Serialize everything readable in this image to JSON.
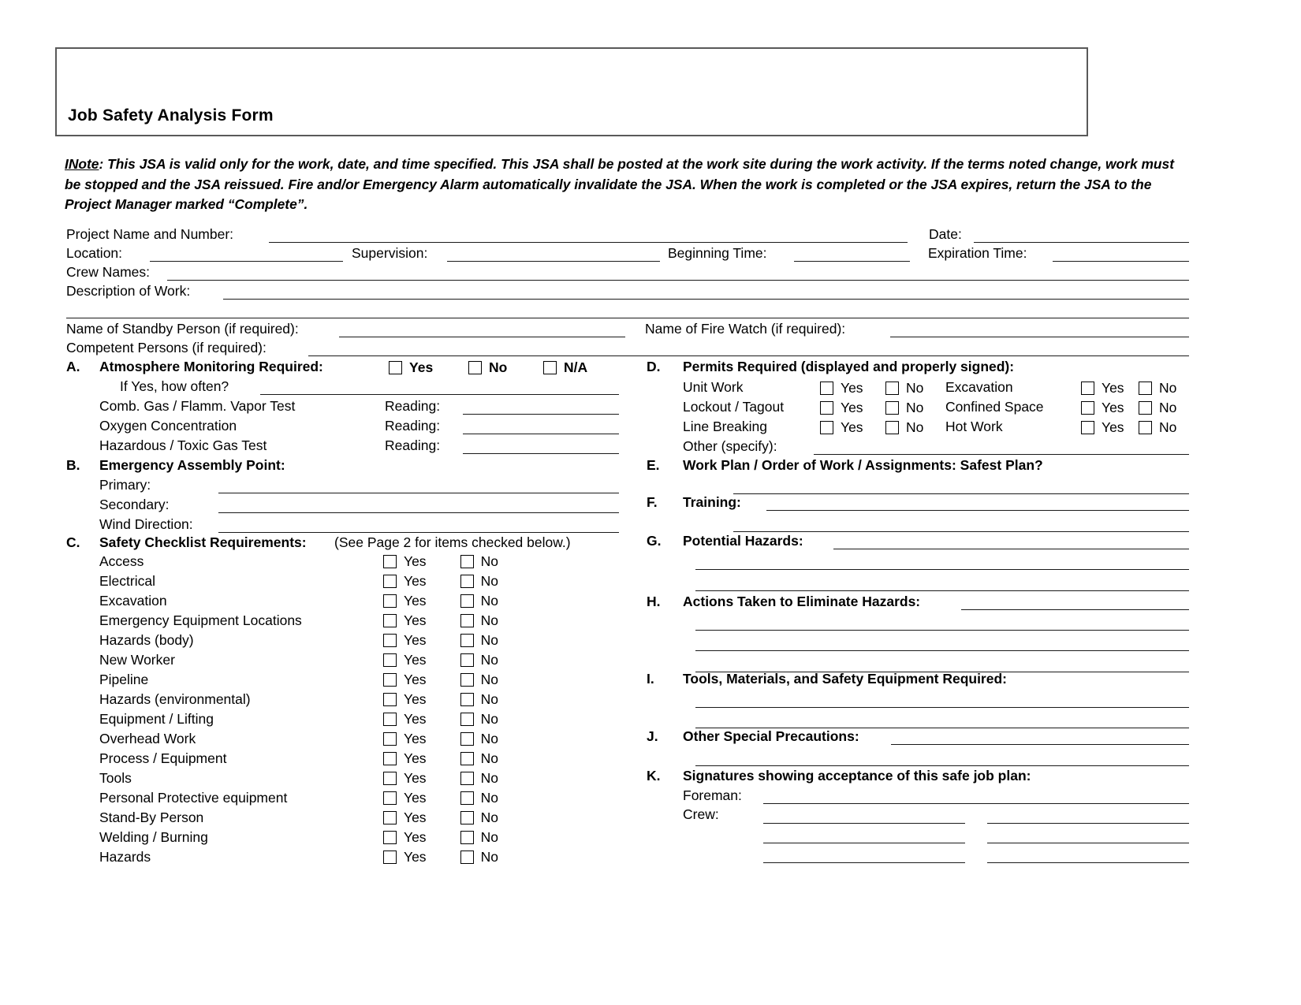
{
  "document": {
    "title": "Job Safety Analysis Form",
    "note_label": "INote",
    "note_body": ":  This JSA is valid only for the work, date, and time specified.  This JSA shall be posted at the work site during the work activity.  If the terms noted change, work must be stopped and the JSA reissued.  Fire and/or Emergency Alarm automatically invalidate the JSA.  When the work is completed or the JSA expires, return the JSA to the Project Manager marked “Complete”."
  },
  "header_fields": {
    "project_name_and_number": "Project Name and Number:",
    "date": "Date:",
    "location": "Location:",
    "supervision": "Supervision:",
    "beginning_time": "Beginning Time:",
    "expiration_time": "Expiration Time:",
    "crew_names": "Crew Names:",
    "description_of_work": "Description of Work:",
    "standby_person": "Name of Standby Person (if required):",
    "fire_watch": "Name of Fire Watch (if required):",
    "competent_persons": "Competent Persons (if required):"
  },
  "section_a": {
    "letter": "A.",
    "title": "Atmosphere Monitoring Required:",
    "options": [
      "Yes",
      "No",
      "N/A"
    ],
    "how_often_label": "If Yes, how often?",
    "tests": [
      {
        "name": "Comb. Gas / Flamm. Vapor Test",
        "reading_label": "Reading:"
      },
      {
        "name": "Oxygen Concentration",
        "reading_label": "Reading:"
      },
      {
        "name": "Hazardous / Toxic Gas Test",
        "reading_label": "Reading:"
      }
    ]
  },
  "section_b": {
    "letter": "B.",
    "title": "Emergency Assembly Point:",
    "fields": [
      "Primary:",
      "Secondary:",
      "Wind Direction:"
    ]
  },
  "section_c": {
    "letter": "C.",
    "title": "Safety Checklist Requirements:",
    "subtitle": "(See Page 2 for items checked below.)",
    "yes_label": "Yes",
    "no_label": "No",
    "items": [
      "Access",
      "Electrical",
      "Excavation",
      "Emergency Equipment Locations",
      "Hazards (body)",
      "New Worker",
      "Pipeline",
      "Hazards (environmental)",
      "Equipment / Lifting",
      "Overhead Work",
      "Process / Equipment",
      "Tools",
      "Personal Protective equipment",
      "Stand-By Person",
      "Welding / Burning",
      "Hazards"
    ]
  },
  "section_d": {
    "letter": "D.",
    "title": "Permits Required (displayed and properly signed):",
    "yes_label": "Yes",
    "no_label": "No",
    "left_items": [
      "Unit Work",
      "Lockout / Tagout",
      "Line Breaking"
    ],
    "right_items": [
      "Excavation",
      "Confined Space",
      "Hot Work"
    ],
    "other_label": "Other (specify):"
  },
  "section_e": {
    "letter": "E.",
    "title": "Work Plan / Order of Work / Assignments:  Safest Plan?"
  },
  "section_f": {
    "letter": "F.",
    "title": "Training:"
  },
  "section_g": {
    "letter": "G.",
    "title": "Potential Hazards:"
  },
  "section_h": {
    "letter": "H.",
    "title": "Actions Taken to Eliminate Hazards:"
  },
  "section_i": {
    "letter": "I.",
    "title": "Tools, Materials, and Safety Equipment Required:"
  },
  "section_j": {
    "letter": "J.",
    "title": "Other Special Precautions:"
  },
  "section_k": {
    "letter": "K.",
    "title": "Signatures showing acceptance of this safe job plan:",
    "foreman_label": "Foreman:",
    "crew_label": "Crew:"
  },
  "colors": {
    "ink": "#000000",
    "rule": "#1a1a1a",
    "box_border": "#595959",
    "paper": "#ffffff"
  }
}
